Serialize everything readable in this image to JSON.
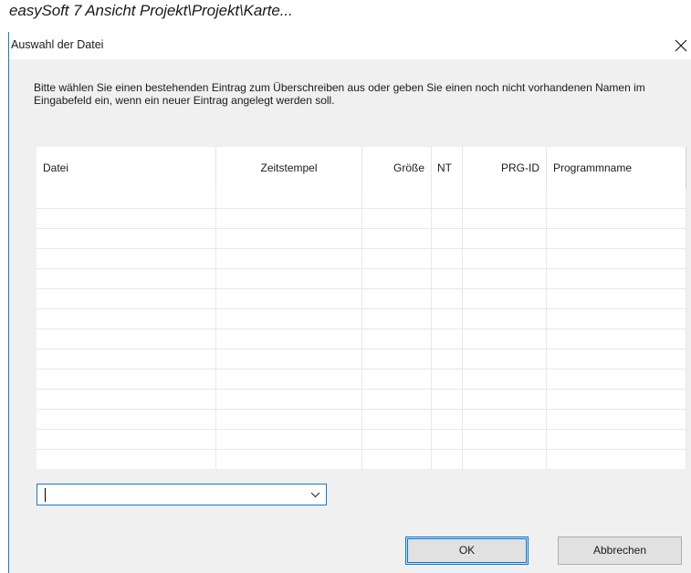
{
  "caption": "easySoft 7 Ansicht Projekt\\Projekt\\Karte...",
  "dialog": {
    "title": "Auswahl der Datei",
    "close_symbol": "close-icon",
    "instruction": "Bitte wählen Sie einen bestehenden Eintrag zum Überschreiben aus oder geben Sie einen noch nicht vorhandenen Namen im Eingabefeld ein, wenn ein neuer Eintrag angelegt werden soll.",
    "table": {
      "columns": [
        {
          "label": "Datei"
        },
        {
          "label": "Zeitstempel"
        },
        {
          "label": "Größe"
        },
        {
          "label": "NT"
        },
        {
          "label": "PRG-ID"
        },
        {
          "label": "Programmname"
        }
      ],
      "rows": []
    },
    "filename_input": {
      "value": "",
      "dropdown_icon": "chevron-down-icon"
    },
    "buttons": {
      "ok": "OK",
      "cancel": "Abbrechen"
    },
    "colors": {
      "accent": "#0078d7",
      "border": "#1979ca",
      "dialog_bg": "#f0f0f0"
    }
  }
}
